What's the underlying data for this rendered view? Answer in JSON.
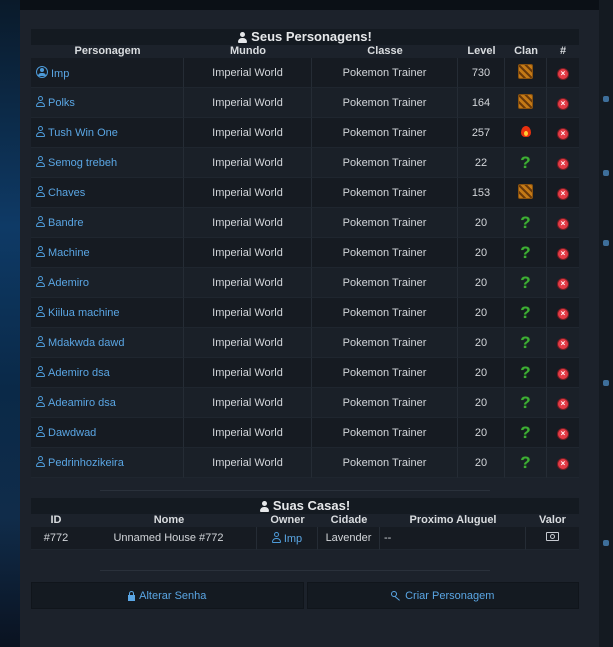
{
  "characters_section": {
    "title": "Seus Personagens!",
    "headers": {
      "name": "Personagem",
      "world": "Mundo",
      "class": "Classe",
      "level": "Level",
      "clan": "Clan",
      "action": "#"
    },
    "rows": [
      {
        "name": "Imp",
        "world": "Imperial World",
        "class": "Pokemon Trainer",
        "level": "730",
        "clan": "clan-emblem-icon",
        "active": true
      },
      {
        "name": "Polks",
        "world": "Imperial World",
        "class": "Pokemon Trainer",
        "level": "164",
        "clan": "clan-emblem-icon"
      },
      {
        "name": "Tush Win One",
        "world": "Imperial World",
        "class": "Pokemon Trainer",
        "level": "257",
        "clan": "fire-icon"
      },
      {
        "name": "Semog trebeh",
        "world": "Imperial World",
        "class": "Pokemon Trainer",
        "level": "22",
        "clan": "question-icon"
      },
      {
        "name": "Chaves",
        "world": "Imperial World",
        "class": "Pokemon Trainer",
        "level": "153",
        "clan": "clan-emblem-icon"
      },
      {
        "name": "Bandre",
        "world": "Imperial World",
        "class": "Pokemon Trainer",
        "level": "20",
        "clan": "question-icon"
      },
      {
        "name": "Machine",
        "world": "Imperial World",
        "class": "Pokemon Trainer",
        "level": "20",
        "clan": "question-icon"
      },
      {
        "name": "Ademiro",
        "world": "Imperial World",
        "class": "Pokemon Trainer",
        "level": "20",
        "clan": "question-icon"
      },
      {
        "name": "Kiilua machine",
        "world": "Imperial World",
        "class": "Pokemon Trainer",
        "level": "20",
        "clan": "question-icon"
      },
      {
        "name": "Mdakwda dawd",
        "world": "Imperial World",
        "class": "Pokemon Trainer",
        "level": "20",
        "clan": "question-icon"
      },
      {
        "name": "Ademiro dsa",
        "world": "Imperial World",
        "class": "Pokemon Trainer",
        "level": "20",
        "clan": "question-icon"
      },
      {
        "name": "Adeamiro dsa",
        "world": "Imperial World",
        "class": "Pokemon Trainer",
        "level": "20",
        "clan": "question-icon"
      },
      {
        "name": "Dawdwad",
        "world": "Imperial World",
        "class": "Pokemon Trainer",
        "level": "20",
        "clan": "question-icon"
      },
      {
        "name": "Pedrinhozikeira",
        "world": "Imperial World",
        "class": "Pokemon Trainer",
        "level": "20",
        "clan": "question-icon"
      }
    ]
  },
  "houses_section": {
    "title": "Suas Casas!",
    "headers": {
      "id": "ID",
      "name": "Nome",
      "owner": "Owner",
      "city": "Cidade",
      "rent": "Proximo Aluguel",
      "value": "Valor"
    },
    "rows": [
      {
        "id": "#772",
        "name": "Unnamed House #772",
        "owner": "Imp",
        "city": "Lavender",
        "rent": "--",
        "value": "money-icon"
      }
    ]
  },
  "buttons": {
    "change_password": "Alterar Senha",
    "create_character": "Criar Personagem"
  },
  "colors": {
    "link": "#5aa6e4",
    "panel": "#1c222b",
    "delete": "#e43b46",
    "unknown_clan": "#3fae35"
  }
}
